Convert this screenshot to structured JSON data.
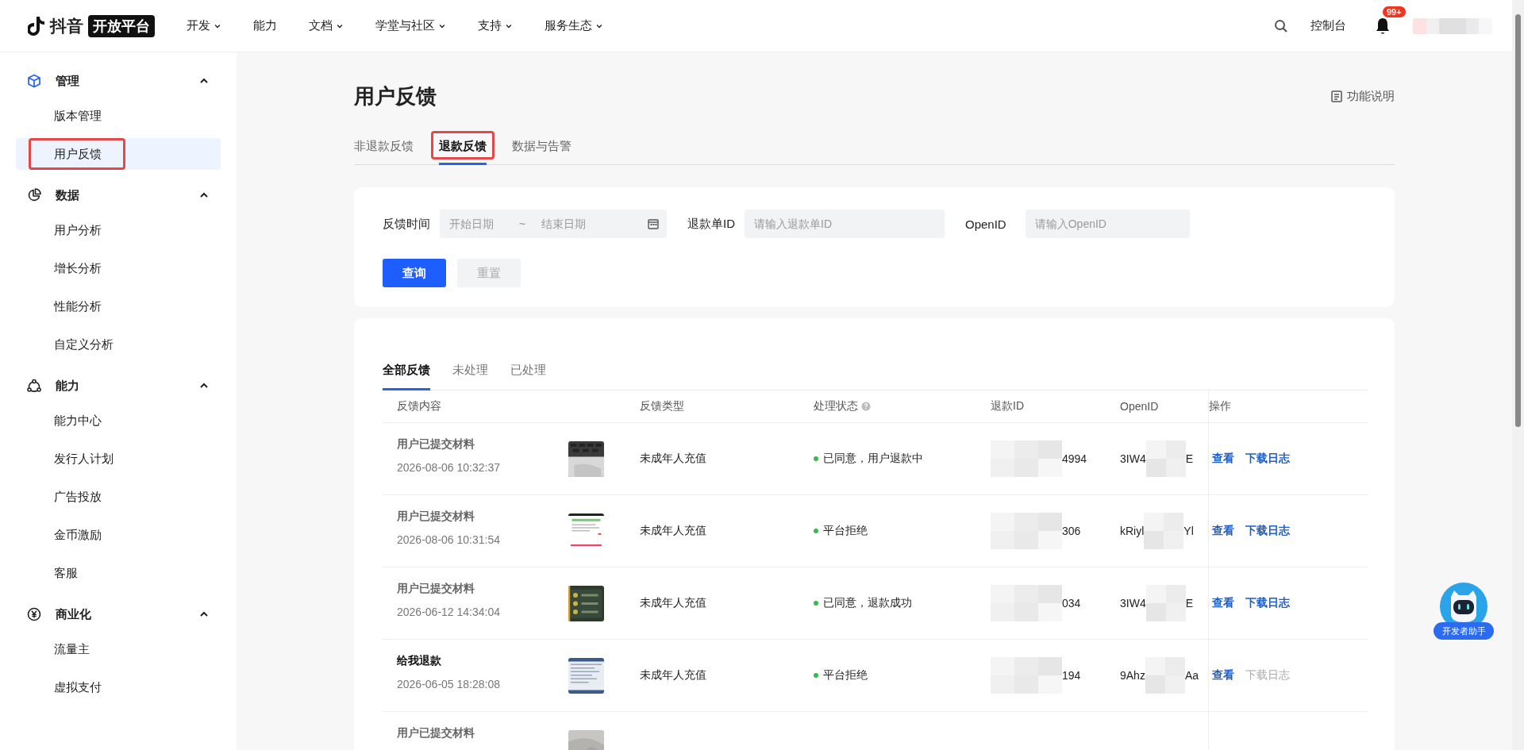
{
  "brand": {
    "name": "抖音",
    "badge": "开放平台"
  },
  "nav": [
    {
      "label": "开发",
      "dropdown": true
    },
    {
      "label": "能力",
      "dropdown": false
    },
    {
      "label": "文档",
      "dropdown": true
    },
    {
      "label": "学堂与社区",
      "dropdown": true
    },
    {
      "label": "支持",
      "dropdown": true
    },
    {
      "label": "服务生态",
      "dropdown": true
    }
  ],
  "header_right": {
    "console": "控制台",
    "notification_count": "99+"
  },
  "sidebar": [
    {
      "title": "管理",
      "expanded": true,
      "children": [
        {
          "label": "版本管理",
          "selected": false,
          "highlighted": false
        },
        {
          "label": "用户反馈",
          "selected": true,
          "highlighted": true
        }
      ]
    },
    {
      "title": "数据",
      "expanded": true,
      "children": [
        {
          "label": "用户分析",
          "selected": false,
          "highlighted": false
        },
        {
          "label": "增长分析",
          "selected": false,
          "highlighted": false
        },
        {
          "label": "性能分析",
          "selected": false,
          "highlighted": false
        },
        {
          "label": "自定义分析",
          "selected": false,
          "highlighted": false
        }
      ]
    },
    {
      "title": "能力",
      "expanded": true,
      "children": [
        {
          "label": "能力中心",
          "selected": false,
          "highlighted": false
        },
        {
          "label": "发行人计划",
          "selected": false,
          "highlighted": false
        },
        {
          "label": "广告投放",
          "selected": false,
          "highlighted": false
        },
        {
          "label": "金币激励",
          "selected": false,
          "highlighted": false
        },
        {
          "label": "客服",
          "selected": false,
          "highlighted": false
        }
      ]
    },
    {
      "title": "商业化",
      "expanded": true,
      "children": [
        {
          "label": "流量主",
          "selected": false,
          "highlighted": false
        },
        {
          "label": "虚拟支付",
          "selected": false,
          "highlighted": false
        }
      ]
    }
  ],
  "page": {
    "title": "用户反馈",
    "help_link": "功能说明",
    "tabs": [
      {
        "label": "非退款反馈",
        "selected": false,
        "highlighted": false
      },
      {
        "label": "退款反馈",
        "selected": true,
        "highlighted": true
      },
      {
        "label": "数据与告警",
        "selected": false,
        "highlighted": false
      }
    ]
  },
  "filter": {
    "date_label": "反馈时间",
    "start_placeholder": "开始日期",
    "range_separator": "~",
    "end_placeholder": "结束日期",
    "refund_label": "退款单ID",
    "refund_placeholder": "请输入退款单ID",
    "openid_label": "OpenID",
    "openid_placeholder": "请输入OpenID",
    "buttons": [
      {
        "label": "查询",
        "kind": "primary"
      },
      {
        "label": "重置",
        "kind": "secondary"
      }
    ]
  },
  "feedback": {
    "tabs": [
      {
        "label": "全部反馈",
        "selected": true
      },
      {
        "label": "未处理",
        "selected": false
      },
      {
        "label": "已处理",
        "selected": false
      }
    ],
    "columns": [
      {
        "label": "反馈内容"
      },
      {
        "label": "反馈类型"
      },
      {
        "label": "处理状态",
        "help": true
      },
      {
        "label": "退款ID"
      },
      {
        "label": "OpenID"
      },
      {
        "label": "操作"
      }
    ],
    "rows": [
      {
        "content": "用户已提交材料",
        "emphasis": false,
        "time": "2026-08-06 10:32:37",
        "type": "未成年人充值",
        "status": "已同意，用户退款中",
        "refund_id": "4994",
        "openid_head": "3IW4",
        "openid_tail": "E",
        "actions": [
          {
            "label": "查看",
            "disabled": false
          },
          {
            "label": "下载日志",
            "disabled": false
          }
        ]
      },
      {
        "content": "用户已提交材料",
        "emphasis": false,
        "time": "2026-08-06 10:31:54",
        "type": "未成年人充值",
        "status": "平台拒绝",
        "refund_id": "306",
        "openid_head": "kRiyl",
        "openid_tail": "Yl",
        "actions": [
          {
            "label": "查看",
            "disabled": false
          },
          {
            "label": "下载日志",
            "disabled": false
          }
        ]
      },
      {
        "content": "用户已提交材料",
        "emphasis": false,
        "time": "2026-06-12 14:34:04",
        "type": "未成年人充值",
        "status": "已同意，退款成功",
        "refund_id": "034",
        "openid_head": "3IW4",
        "openid_tail": "E",
        "actions": [
          {
            "label": "查看",
            "disabled": false
          },
          {
            "label": "下载日志",
            "disabled": false
          }
        ]
      },
      {
        "content": "给我退款",
        "emphasis": true,
        "time": "2026-06-05 18:28:08",
        "type": "未成年人充值",
        "status": "平台拒绝",
        "refund_id": "194",
        "openid_head": "9Ahz",
        "openid_tail": "Aa",
        "actions": [
          {
            "label": "查看",
            "disabled": false
          },
          {
            "label": "下载日志",
            "disabled": true
          }
        ]
      },
      {
        "content": "用户已提交材料",
        "emphasis": false
      }
    ]
  },
  "assistant": {
    "label": "开发者助手"
  }
}
